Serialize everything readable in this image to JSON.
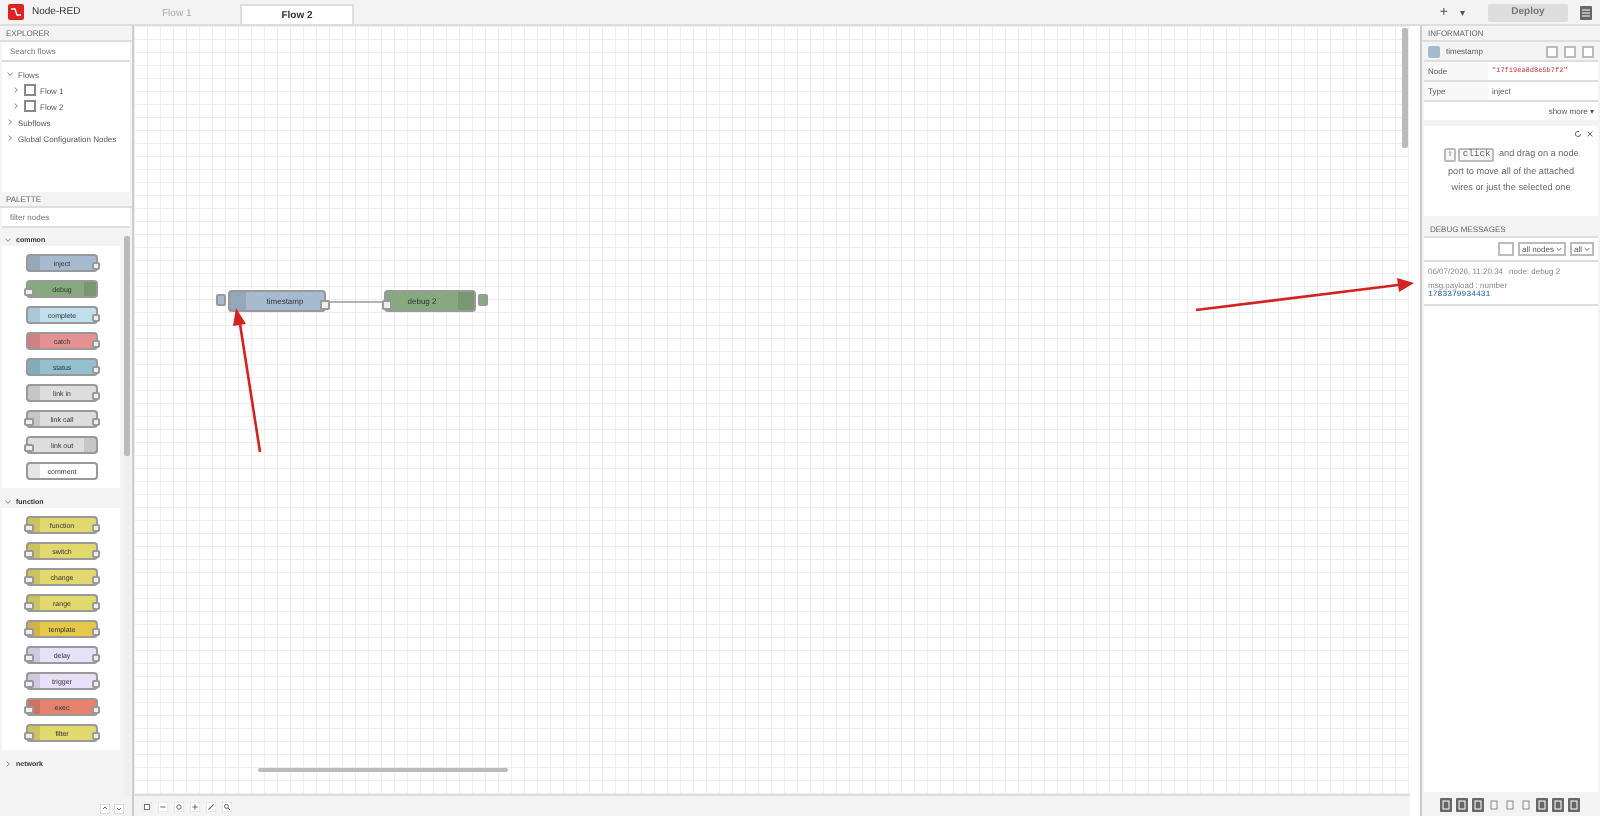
{
  "header": {
    "title": "Node-RED",
    "tabs": [
      {
        "label": "Flow 1",
        "selected": false
      },
      {
        "label": "Flow 2",
        "selected": true
      }
    ],
    "add": "+",
    "more": "▾",
    "deploy": {
      "label": "Deploy",
      "disabled": true
    }
  },
  "explorer": {
    "title": "EXPLORER",
    "search": {
      "placeholder": "Search flows"
    },
    "tree": [
      {
        "label": "Flows",
        "expanded": true,
        "children": [
          {
            "label": "Flow 1",
            "expanded": false
          },
          {
            "label": "Flow 2",
            "expanded": false
          }
        ]
      },
      {
        "label": "Subflows",
        "expanded": false
      },
      {
        "label": "Global Configuration Nodes",
        "expanded": false
      }
    ]
  },
  "palette": {
    "title": "PALETTE",
    "search": {
      "placeholder": "filter nodes"
    },
    "categories": [
      {
        "name": "common",
        "expanded": true,
        "nodes": [
          {
            "label": "inject",
            "color": "#a6bbcf",
            "input": false,
            "output": true
          },
          {
            "label": "debug",
            "color": "#87a980",
            "input": true,
            "output": false
          },
          {
            "label": "complete",
            "color": "#c0deed",
            "input": false,
            "output": true
          },
          {
            "label": "catch",
            "color": "#e49191",
            "input": false,
            "output": true
          },
          {
            "label": "status",
            "color": "#94c1d0",
            "input": false,
            "output": true
          },
          {
            "label": "link in",
            "color": "#dddddd",
            "input": false,
            "output": true
          },
          {
            "label": "link call",
            "color": "#dddddd",
            "input": true,
            "output": true
          },
          {
            "label": "link out",
            "color": "#dddddd",
            "input": true,
            "output": false
          },
          {
            "label": "comment",
            "color": "#ffffff",
            "input": false,
            "output": false
          }
        ]
      },
      {
        "name": "function",
        "expanded": true,
        "nodes": [
          {
            "label": "function",
            "color": "#e2d96e",
            "input": true,
            "output": true
          },
          {
            "label": "switch",
            "color": "#e2d96e",
            "input": true,
            "output": true
          },
          {
            "label": "change",
            "color": "#e2d96e",
            "input": true,
            "output": true
          },
          {
            "label": "range",
            "color": "#e2d96e",
            "input": true,
            "output": true
          },
          {
            "label": "template",
            "color": "#e8c84a",
            "input": true,
            "output": true
          },
          {
            "label": "delay",
            "color": "#e6e0f8",
            "input": true,
            "output": true
          },
          {
            "label": "trigger",
            "color": "#e6e0f8",
            "input": true,
            "output": true
          },
          {
            "label": "exec",
            "color": "#e4826d",
            "input": true,
            "output": true
          },
          {
            "label": "filter",
            "color": "#e2d96e",
            "input": true,
            "output": true
          }
        ]
      },
      {
        "name": "network",
        "expanded": false
      }
    ]
  },
  "canvas": {
    "nodes": [
      {
        "label": "timestamp",
        "color": "#a6bbcf",
        "kind": "inject"
      },
      {
        "label": "debug 2",
        "color": "#87a980",
        "kind": "debug"
      }
    ]
  },
  "info": {
    "title": "INFORMATION",
    "node": "timestamp",
    "rows": [
      {
        "label": "Node",
        "value": "\"17f19ea8d8e5b7f2\""
      },
      {
        "label": "Type",
        "value": "inject"
      }
    ],
    "show_more": "show more ▾"
  },
  "help": {
    "keys": [
      "⇧",
      "click"
    ],
    "text": "and drag on a node port to move all of the attached wires or just the selected one"
  },
  "debug": {
    "title": "DEBUG MESSAGES",
    "filter": "all nodes",
    "scope": "all",
    "messages": [
      {
        "time": "06/07/2026, 11:20:34",
        "source": "node: debug 2",
        "topic": "msg.payload : number",
        "value": "1783379934431"
      }
    ]
  }
}
